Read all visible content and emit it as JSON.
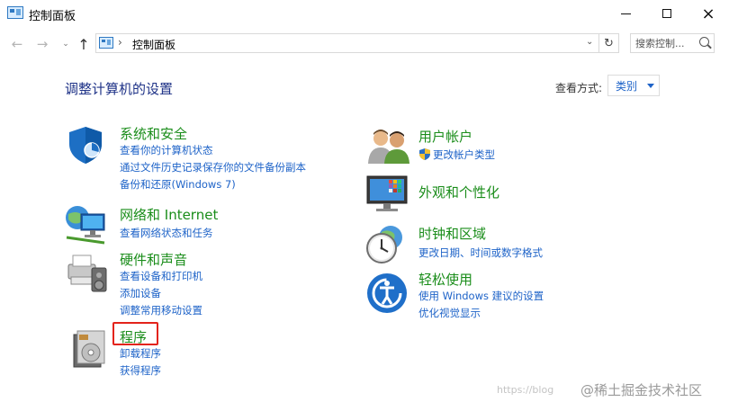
{
  "window": {
    "title": "控制面板",
    "controls": {
      "minimize": "minimize-icon",
      "maximize": "maximize-icon",
      "close": "×"
    }
  },
  "address_bar": {
    "back": "←",
    "forward": "→",
    "recent": "⌄",
    "up": "↑",
    "separator": "›",
    "path": "控制面板",
    "dropdown": "⌄",
    "refresh": "↻",
    "search_placeholder": "搜索控制..."
  },
  "header": {
    "title": "调整计算机的设置",
    "view_by_label": "查看方式:",
    "view_by_value": "类别"
  },
  "categories_left": [
    {
      "title": "系统和安全",
      "icon": "shield-icon",
      "links": [
        "查看你的计算机状态",
        "通过文件历史记录保存你的文件备份副本",
        "备份和还原(Windows 7)"
      ]
    },
    {
      "title": "网络和 Internet",
      "icon": "network-globe-icon",
      "links": [
        "查看网络状态和任务"
      ]
    },
    {
      "title": "硬件和声音",
      "icon": "printer-speaker-icon",
      "links": [
        "查看设备和打印机",
        "添加设备",
        "调整常用移动设置"
      ]
    },
    {
      "title": "程序",
      "icon": "programs-disc-icon",
      "links": [
        "卸载程序",
        "获得程序"
      ]
    }
  ],
  "categories_right": [
    {
      "title": "用户帐户",
      "icon": "users-icon",
      "links": [
        "更改帐户类型"
      ]
    },
    {
      "title": "外观和个性化",
      "icon": "monitor-palette-icon",
      "links": []
    },
    {
      "title": "时钟和区域",
      "icon": "clock-globe-icon",
      "links": [
        "更改日期、时间或数字格式"
      ]
    },
    {
      "title": "轻松使用",
      "icon": "ease-of-access-icon",
      "links": [
        "使用 Windows 建议的设置",
        "优化视觉显示"
      ]
    }
  ],
  "watermark": {
    "url": "https://blog",
    "brand": "@稀土掘金技术社区"
  },
  "colors": {
    "category_title": "#1a8d1a",
    "link": "#1e63c8",
    "page_title": "#1e3287",
    "highlight": "#e3231b"
  }
}
